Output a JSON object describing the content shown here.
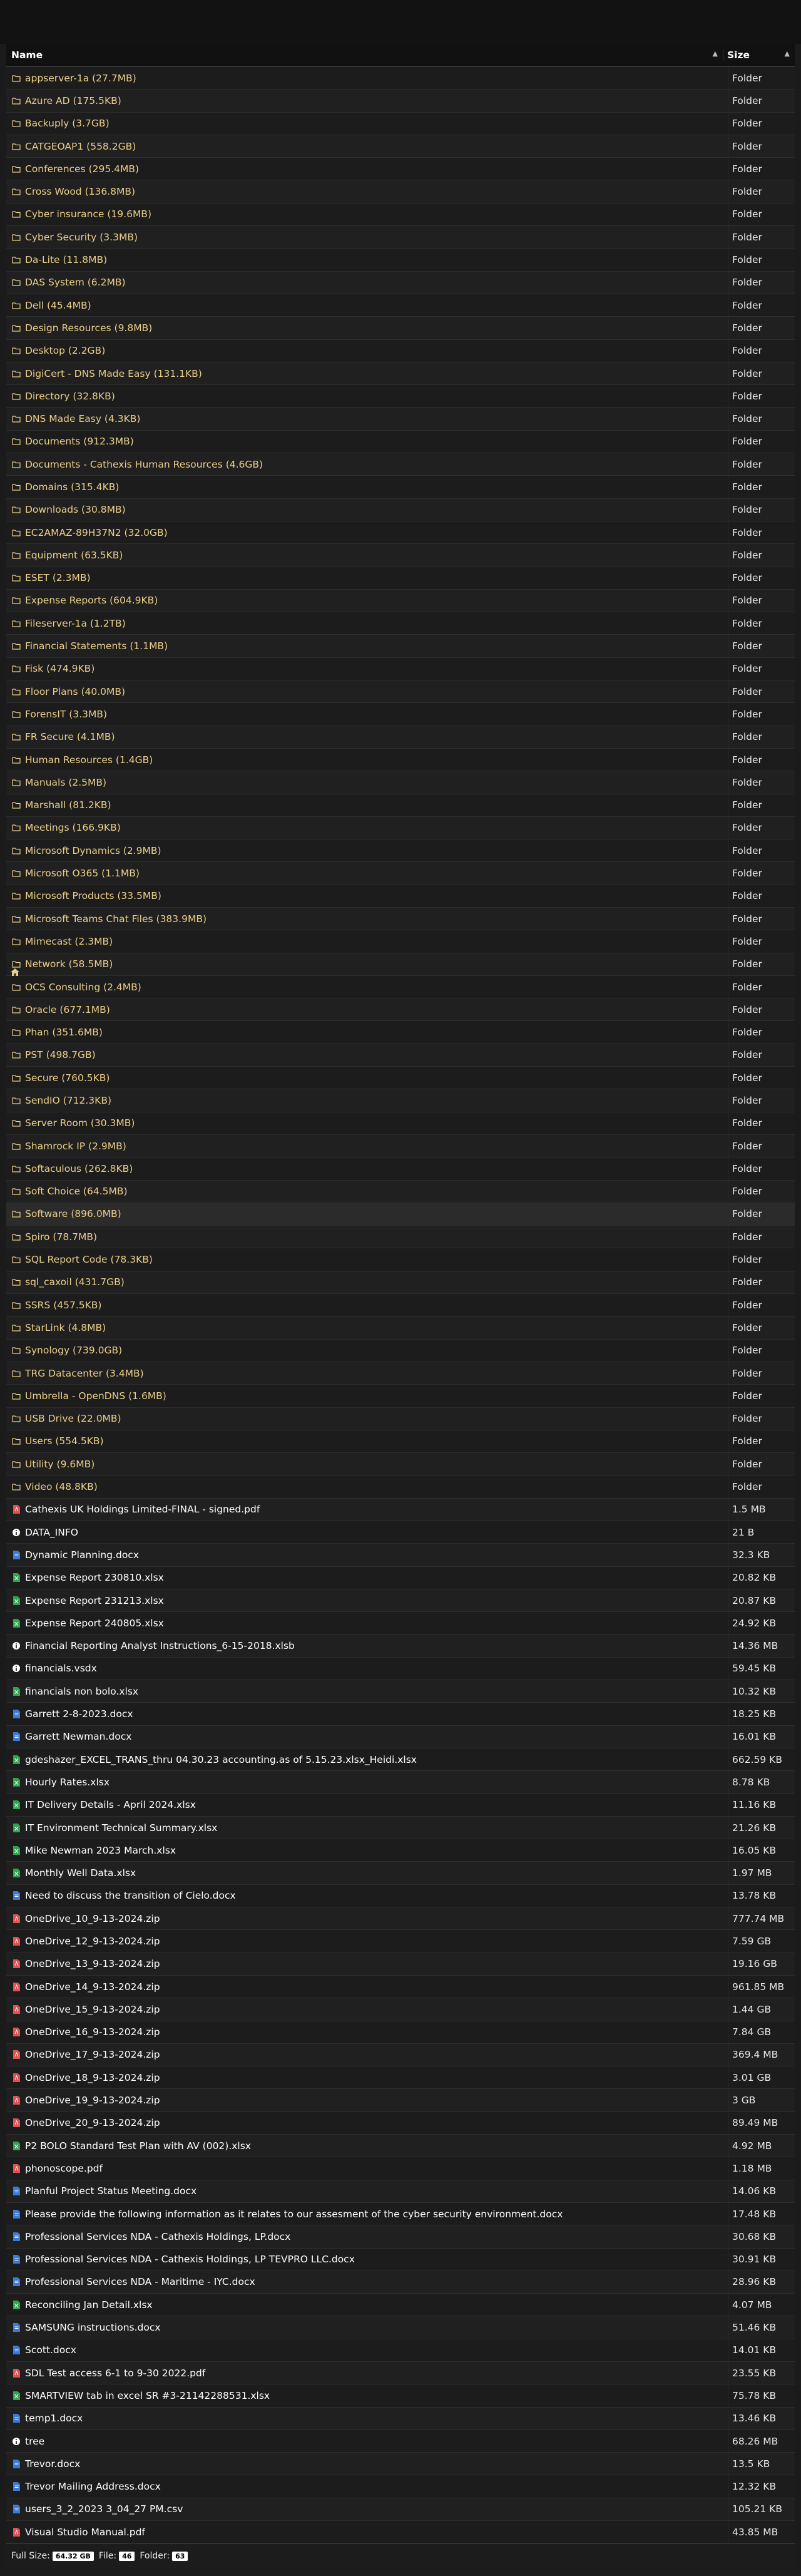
{
  "header": {
    "name_label": "Name",
    "size_label": "Size",
    "sort_icon": "sort-arrows-icon"
  },
  "colors": {
    "folder": "#e9cf8a",
    "file_text": "#ffffff",
    "pdf": "#e05252",
    "docx": "#3a7bd5",
    "xlsx": "#2ea44f",
    "info": "#ffffff"
  },
  "rows": [
    {
      "kind": "dir",
      "icon": "folder",
      "name": "appserver-1a (27.7MB)",
      "size": "Folder"
    },
    {
      "kind": "dir",
      "icon": "folder",
      "name": "Azure AD (175.5KB)",
      "size": "Folder"
    },
    {
      "kind": "dir",
      "icon": "folder",
      "name": "Backuply (3.7GB)",
      "size": "Folder"
    },
    {
      "kind": "dir",
      "icon": "folder",
      "name": "CATGEOAP1 (558.2GB)",
      "size": "Folder"
    },
    {
      "kind": "dir",
      "icon": "folder",
      "name": "Conferences (295.4MB)",
      "size": "Folder"
    },
    {
      "kind": "dir",
      "icon": "folder",
      "name": "Cross Wood (136.8MB)",
      "size": "Folder"
    },
    {
      "kind": "dir",
      "icon": "folder",
      "name": "Cyber insurance (19.6MB)",
      "size": "Folder"
    },
    {
      "kind": "dir",
      "icon": "folder",
      "name": "Cyber Security (3.3MB)",
      "size": "Folder"
    },
    {
      "kind": "dir",
      "icon": "folder",
      "name": "Da-Lite (11.8MB)",
      "size": "Folder"
    },
    {
      "kind": "dir",
      "icon": "folder",
      "name": "DAS System (6.2MB)",
      "size": "Folder"
    },
    {
      "kind": "dir",
      "icon": "folder",
      "name": "Dell (45.4MB)",
      "size": "Folder"
    },
    {
      "kind": "dir",
      "icon": "folder",
      "name": "Design Resources (9.8MB)",
      "size": "Folder"
    },
    {
      "kind": "dir",
      "icon": "folder",
      "name": "Desktop (2.2GB)",
      "size": "Folder"
    },
    {
      "kind": "dir",
      "icon": "folder",
      "name": "DigiCert - DNS Made Easy (131.1KB)",
      "size": "Folder"
    },
    {
      "kind": "dir",
      "icon": "folder",
      "name": "Directory (32.8KB)",
      "size": "Folder"
    },
    {
      "kind": "dir",
      "icon": "folder",
      "name": "DNS Made Easy (4.3KB)",
      "size": "Folder"
    },
    {
      "kind": "dir",
      "icon": "folder",
      "name": "Documents (912.3MB)",
      "size": "Folder"
    },
    {
      "kind": "dir",
      "icon": "folder",
      "name": "Documents - Cathexis Human Resources (4.6GB)",
      "size": "Folder"
    },
    {
      "kind": "dir",
      "icon": "folder",
      "name": "Domains (315.4KB)",
      "size": "Folder"
    },
    {
      "kind": "dir",
      "icon": "folder",
      "name": "Downloads (30.8MB)",
      "size": "Folder"
    },
    {
      "kind": "dir",
      "icon": "folder",
      "name": "EC2AMAZ-89H37N2 (32.0GB)",
      "size": "Folder"
    },
    {
      "kind": "dir",
      "icon": "folder",
      "name": "Equipment (63.5KB)",
      "size": "Folder"
    },
    {
      "kind": "dir",
      "icon": "folder",
      "name": "ESET (2.3MB)",
      "size": "Folder"
    },
    {
      "kind": "dir",
      "icon": "folder",
      "name": "Expense Reports (604.9KB)",
      "size": "Folder"
    },
    {
      "kind": "dir",
      "icon": "folder",
      "name": "Fileserver-1a (1.2TB)",
      "size": "Folder"
    },
    {
      "kind": "dir",
      "icon": "folder",
      "name": "Financial Statements (1.1MB)",
      "size": "Folder"
    },
    {
      "kind": "dir",
      "icon": "folder",
      "name": "Fisk (474.9KB)",
      "size": "Folder"
    },
    {
      "kind": "dir",
      "icon": "folder",
      "name": "Floor Plans (40.0MB)",
      "size": "Folder"
    },
    {
      "kind": "dir",
      "icon": "folder",
      "name": "ForensIT (3.3MB)",
      "size": "Folder"
    },
    {
      "kind": "dir",
      "icon": "folder",
      "name": "FR Secure (4.1MB)",
      "size": "Folder"
    },
    {
      "kind": "dir",
      "icon": "folder",
      "name": "Human Resources (1.4GB)",
      "size": "Folder"
    },
    {
      "kind": "dir",
      "icon": "folder",
      "name": "Manuals (2.5MB)",
      "size": "Folder"
    },
    {
      "kind": "dir",
      "icon": "folder",
      "name": "Marshall (81.2KB)",
      "size": "Folder"
    },
    {
      "kind": "dir",
      "icon": "folder",
      "name": "Meetings (166.9KB)",
      "size": "Folder"
    },
    {
      "kind": "dir",
      "icon": "folder",
      "name": "Microsoft Dynamics (2.9MB)",
      "size": "Folder"
    },
    {
      "kind": "dir",
      "icon": "folder",
      "name": "Microsoft O365 (1.1MB)",
      "size": "Folder"
    },
    {
      "kind": "dir",
      "icon": "folder",
      "name": "Microsoft Products (33.5MB)",
      "size": "Folder"
    },
    {
      "kind": "dir",
      "icon": "folder",
      "name": "Microsoft Teams Chat Files (383.9MB)",
      "size": "Folder"
    },
    {
      "kind": "dir",
      "icon": "folder",
      "name": "Mimecast (2.3MB)",
      "size": "Folder"
    },
    {
      "kind": "dir",
      "icon": "folder",
      "name": "Network (58.5MB)",
      "size": "Folder"
    },
    {
      "kind": "dir",
      "icon": "folder",
      "name": "OCS Consulting (2.4MB)",
      "size": "Folder"
    },
    {
      "kind": "dir",
      "icon": "folder",
      "name": "Oracle (677.1MB)",
      "size": "Folder"
    },
    {
      "kind": "dir",
      "icon": "folder",
      "name": "Phan (351.6MB)",
      "size": "Folder"
    },
    {
      "kind": "dir",
      "icon": "folder",
      "name": "PST (498.7GB)",
      "size": "Folder"
    },
    {
      "kind": "dir",
      "icon": "folder",
      "name": "Secure (760.5KB)",
      "size": "Folder"
    },
    {
      "kind": "dir",
      "icon": "folder",
      "name": "SendIO (712.3KB)",
      "size": "Folder"
    },
    {
      "kind": "dir",
      "icon": "folder",
      "name": "Server Room (30.3MB)",
      "size": "Folder"
    },
    {
      "kind": "dir",
      "icon": "folder",
      "name": "Shamrock IP (2.9MB)",
      "size": "Folder"
    },
    {
      "kind": "dir",
      "icon": "folder",
      "name": "Softaculous (262.8KB)",
      "size": "Folder"
    },
    {
      "kind": "dir",
      "icon": "folder",
      "name": "Soft Choice (64.5MB)",
      "size": "Folder"
    },
    {
      "kind": "dir",
      "icon": "folder",
      "name": "Software (896.0MB)",
      "size": "Folder",
      "hl": true
    },
    {
      "kind": "dir",
      "icon": "folder",
      "name": "Spiro (78.7MB)",
      "size": "Folder"
    },
    {
      "kind": "dir",
      "icon": "folder",
      "name": "SQL Report Code (78.3KB)",
      "size": "Folder"
    },
    {
      "kind": "dir",
      "icon": "folder",
      "name": "sql_caxoil (431.7GB)",
      "size": "Folder"
    },
    {
      "kind": "dir",
      "icon": "folder",
      "name": "SSRS (457.5KB)",
      "size": "Folder"
    },
    {
      "kind": "dir",
      "icon": "folder",
      "name": "StarLink (4.8MB)",
      "size": "Folder"
    },
    {
      "kind": "dir",
      "icon": "folder",
      "name": "Synology (739.0GB)",
      "size": "Folder"
    },
    {
      "kind": "dir",
      "icon": "folder",
      "name": "TRG Datacenter (3.4MB)",
      "size": "Folder"
    },
    {
      "kind": "dir",
      "icon": "folder",
      "name": "Umbrella - OpenDNS (1.6MB)",
      "size": "Folder"
    },
    {
      "kind": "dir",
      "icon": "folder",
      "name": "USB Drive (22.0MB)",
      "size": "Folder"
    },
    {
      "kind": "dir",
      "icon": "folder",
      "name": "Users (554.5KB)",
      "size": "Folder"
    },
    {
      "kind": "dir",
      "icon": "folder",
      "name": "Utility (9.6MB)",
      "size": "Folder"
    },
    {
      "kind": "dir",
      "icon": "folder",
      "name": "Video (48.8KB)",
      "size": "Folder"
    },
    {
      "kind": "file",
      "icon": "pdf",
      "name": "Cathexis UK Holdings Limited-FINAL - signed.pdf",
      "size": "1.5 MB"
    },
    {
      "kind": "file",
      "icon": "info",
      "name": "DATA_INFO",
      "size": "21 B"
    },
    {
      "kind": "file",
      "icon": "docx",
      "name": "Dynamic Planning.docx",
      "size": "32.3 KB"
    },
    {
      "kind": "file",
      "icon": "xlsx",
      "name": "Expense Report 230810.xlsx",
      "size": "20.82 KB"
    },
    {
      "kind": "file",
      "icon": "xlsx",
      "name": "Expense Report 231213.xlsx",
      "size": "20.87 KB"
    },
    {
      "kind": "file",
      "icon": "xlsx",
      "name": "Expense Report 240805.xlsx",
      "size": "24.92 KB"
    },
    {
      "kind": "file",
      "icon": "info",
      "name": "Financial Reporting Analyst Instructions_6-15-2018.xlsb",
      "size": "14.36 MB"
    },
    {
      "kind": "file",
      "icon": "info",
      "name": "financials.vsdx",
      "size": "59.45 KB"
    },
    {
      "kind": "file",
      "icon": "xlsx",
      "name": "financials non bolo.xlsx",
      "size": "10.32 KB"
    },
    {
      "kind": "file",
      "icon": "docx",
      "name": "Garrett 2-8-2023.docx",
      "size": "18.25 KB"
    },
    {
      "kind": "file",
      "icon": "docx",
      "name": "Garrett Newman.docx",
      "size": "16.01 KB"
    },
    {
      "kind": "file",
      "icon": "xlsx",
      "name": "gdeshazer_EXCEL_TRANS_thru 04.30.23 accounting.as of 5.15.23.xlsx_Heidi.xlsx",
      "size": "662.59 KB"
    },
    {
      "kind": "file",
      "icon": "xlsx",
      "name": "Hourly Rates.xlsx",
      "size": "8.78 KB"
    },
    {
      "kind": "file",
      "icon": "xlsx",
      "name": "IT Delivery Details - April 2024.xlsx",
      "size": "11.16 KB"
    },
    {
      "kind": "file",
      "icon": "xlsx",
      "name": "IT Environment Technical Summary.xlsx",
      "size": "21.26 KB"
    },
    {
      "kind": "file",
      "icon": "xlsx",
      "name": "Mike Newman 2023 March.xlsx",
      "size": "16.05 KB"
    },
    {
      "kind": "file",
      "icon": "xlsx",
      "name": "Monthly Well Data.xlsx",
      "size": "1.97 MB"
    },
    {
      "kind": "file",
      "icon": "docx",
      "name": "Need to discuss the transition of Cielo.docx",
      "size": "13.78 KB"
    },
    {
      "kind": "file",
      "icon": "zip",
      "name": "OneDrive_10_9-13-2024.zip",
      "size": "777.74 MB"
    },
    {
      "kind": "file",
      "icon": "zip",
      "name": "OneDrive_12_9-13-2024.zip",
      "size": "7.59 GB"
    },
    {
      "kind": "file",
      "icon": "zip",
      "name": "OneDrive_13_9-13-2024.zip",
      "size": "19.16 GB"
    },
    {
      "kind": "file",
      "icon": "zip",
      "name": "OneDrive_14_9-13-2024.zip",
      "size": "961.85 MB"
    },
    {
      "kind": "file",
      "icon": "zip",
      "name": "OneDrive_15_9-13-2024.zip",
      "size": "1.44 GB"
    },
    {
      "kind": "file",
      "icon": "zip",
      "name": "OneDrive_16_9-13-2024.zip",
      "size": "7.84 GB"
    },
    {
      "kind": "file",
      "icon": "zip",
      "name": "OneDrive_17_9-13-2024.zip",
      "size": "369.4 MB"
    },
    {
      "kind": "file",
      "icon": "zip",
      "name": "OneDrive_18_9-13-2024.zip",
      "size": "3.01 GB"
    },
    {
      "kind": "file",
      "icon": "zip",
      "name": "OneDrive_19_9-13-2024.zip",
      "size": "3 GB"
    },
    {
      "kind": "file",
      "icon": "zip",
      "name": "OneDrive_20_9-13-2024.zip",
      "size": "89.49 MB"
    },
    {
      "kind": "file",
      "icon": "xlsx",
      "name": "P2 BOLO Standard Test Plan with AV (002).xlsx",
      "size": "4.92 MB"
    },
    {
      "kind": "file",
      "icon": "pdf",
      "name": "phonoscope.pdf",
      "size": "1.18 MB"
    },
    {
      "kind": "file",
      "icon": "docx",
      "name": "Planful Project Status Meeting.docx",
      "size": "14.06 KB"
    },
    {
      "kind": "file",
      "icon": "docx",
      "name": "Please provide the following information as it relates to our assesment of the cyber security environment.docx",
      "size": "17.48 KB"
    },
    {
      "kind": "file",
      "icon": "docx",
      "name": "Professional Services NDA - Cathexis Holdings, LP.docx",
      "size": "30.68 KB"
    },
    {
      "kind": "file",
      "icon": "docx",
      "name": "Professional Services NDA - Cathexis Holdings, LP TEVPRO LLC.docx",
      "size": "30.91 KB"
    },
    {
      "kind": "file",
      "icon": "docx",
      "name": "Professional Services NDA - Maritime - IYC.docx",
      "size": "28.96 KB"
    },
    {
      "kind": "file",
      "icon": "xlsx",
      "name": "Reconciling Jan Detail.xlsx",
      "size": "4.07 MB"
    },
    {
      "kind": "file",
      "icon": "docx",
      "name": "SAMSUNG instructions.docx",
      "size": "51.46 KB"
    },
    {
      "kind": "file",
      "icon": "docx",
      "name": "Scott.docx",
      "size": "14.01 KB"
    },
    {
      "kind": "file",
      "icon": "pdf",
      "name": "SDL Test access 6-1 to 9-30 2022.pdf",
      "size": "23.55 KB"
    },
    {
      "kind": "file",
      "icon": "xlsx",
      "name": "SMARTVIEW tab in excel SR #3-21142288531.xlsx",
      "size": "75.78 KB"
    },
    {
      "kind": "file",
      "icon": "docx",
      "name": "temp1.docx",
      "size": "13.46 KB"
    },
    {
      "kind": "file",
      "icon": "info",
      "name": "tree",
      "size": "68.26 MB"
    },
    {
      "kind": "file",
      "icon": "docx",
      "name": "Trevor.docx",
      "size": "13.5 KB"
    },
    {
      "kind": "file",
      "icon": "docx",
      "name": "Trevor Mailing Address.docx",
      "size": "12.32 KB"
    },
    {
      "kind": "file",
      "icon": "csv",
      "name": "users_3_2_2023 3_04_27 PM.csv",
      "size": "105.21 KB"
    },
    {
      "kind": "file",
      "icon": "pdf",
      "name": "Visual Studio Manual.pdf",
      "size": "43.85 MB"
    }
  ],
  "footer": {
    "full_size_label": "Full Size:",
    "full_size_value": "64.32 GB",
    "file_label": "File:",
    "file_count": "46",
    "folder_label": "Folder:",
    "folder_count": "63"
  }
}
